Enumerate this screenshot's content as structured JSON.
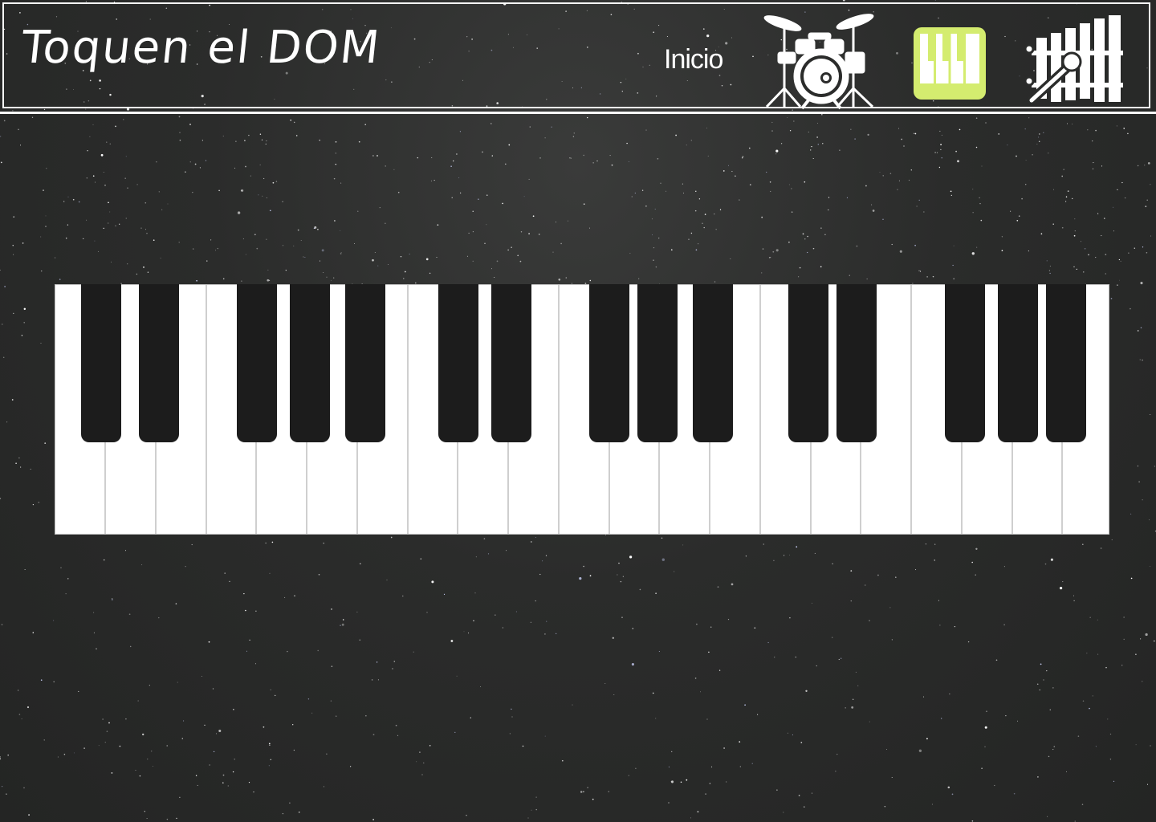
{
  "header": {
    "title": "Toquen el DOM",
    "nav_home": "Inicio",
    "instruments": [
      {
        "name": "drums",
        "icon": "drum-kit-icon",
        "active": false
      },
      {
        "name": "piano",
        "icon": "piano-icon",
        "active": true
      },
      {
        "name": "xylophone",
        "icon": "xylophone-icon",
        "active": false
      }
    ]
  },
  "piano": {
    "white_key_count": 21,
    "black_key_count": 15
  },
  "colors": {
    "background": "#2b2c2b",
    "accent": "#d4ec6f",
    "white_key": "#ffffff",
    "black_key": "#1c1c1c",
    "key_border": "#cfcfcf"
  }
}
